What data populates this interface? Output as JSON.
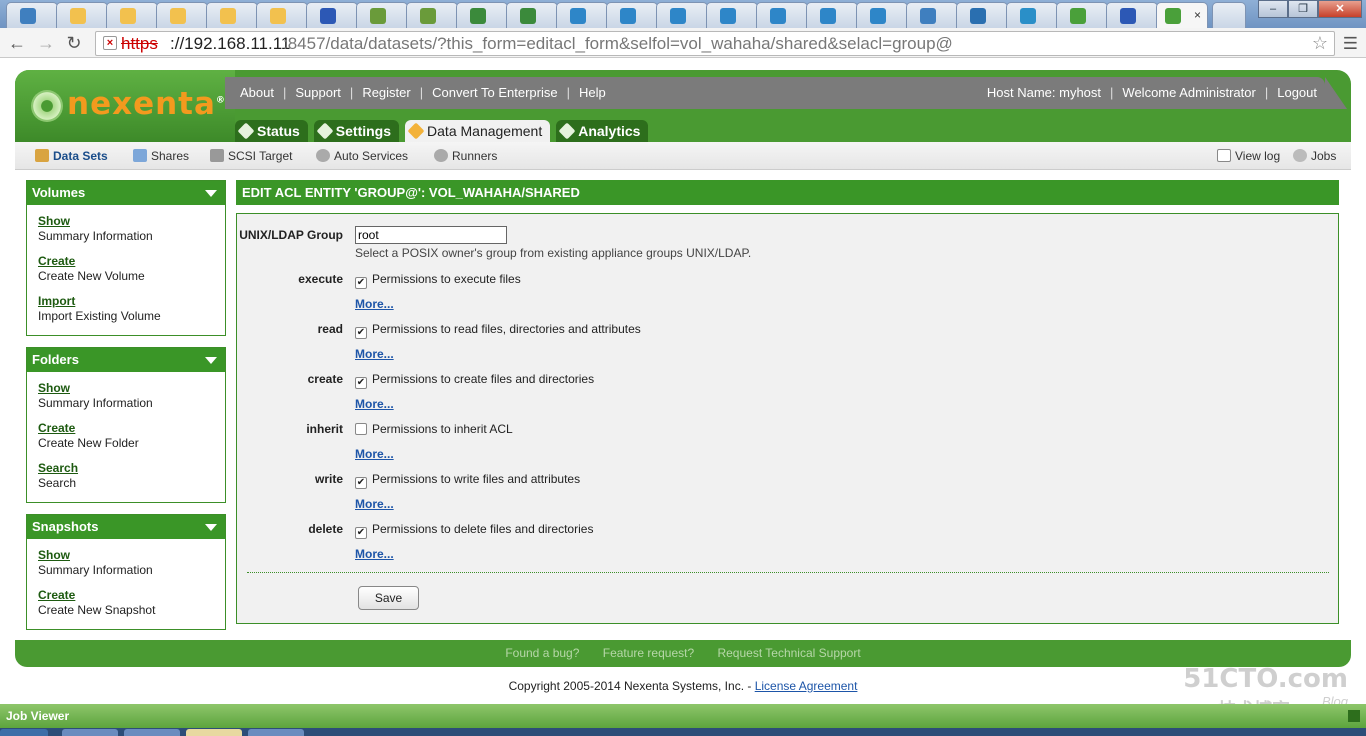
{
  "browser": {
    "tabs": [
      {
        "icon": "nexenta-icon",
        "color": "#3f7fbf"
      },
      {
        "icon": "folder-icon",
        "color": "#f2c14e"
      },
      {
        "icon": "folder-icon",
        "color": "#f2c14e"
      },
      {
        "icon": "folder-icon",
        "color": "#f2c14e"
      },
      {
        "icon": "folder-icon",
        "color": "#f2c14e"
      },
      {
        "icon": "folder-icon",
        "color": "#f2c14e"
      },
      {
        "icon": "paw-icon",
        "color": "#2c58b5"
      },
      {
        "icon": "pencil-icon",
        "color": "#6a9b3a"
      },
      {
        "icon": "pencil-icon",
        "color": "#6a9b3a"
      },
      {
        "icon": "mx-icon",
        "color": "#3b8a3b"
      },
      {
        "icon": "mx-icon",
        "color": "#3b8a3b"
      },
      {
        "icon": "play-circle-icon",
        "color": "#2e86c8"
      },
      {
        "icon": "play-circle-icon",
        "color": "#2e86c8"
      },
      {
        "icon": "play-circle-icon",
        "color": "#2e86c8"
      },
      {
        "icon": "play-circle-icon",
        "color": "#2e86c8"
      },
      {
        "icon": "play-circle-icon",
        "color": "#2e86c8"
      },
      {
        "icon": "play-circle-icon",
        "color": "#2e86c8"
      },
      {
        "icon": "play-circle-icon",
        "color": "#2e86c8"
      },
      {
        "icon": "nexenta-icon",
        "color": "#3f7fbf"
      },
      {
        "icon": "home-icon",
        "color": "#2a6fb0"
      },
      {
        "icon": "app-icon",
        "color": "#2a8fc8"
      },
      {
        "icon": "nexenta-leaf-icon",
        "color": "#4aa03a"
      },
      {
        "icon": "paw-icon",
        "color": "#2c58b5"
      }
    ],
    "active_tab_icon": "nexenta-leaf-icon",
    "active_tab_close": "×",
    "window_controls": {
      "minimize": "‒",
      "maximize": "❐",
      "close": "✕"
    },
    "url_scheme": "https",
    "url_host": "://192.168.11.11",
    "url_path": ":8457/data/datasets/?this_form=editacl_form&selfol=vol_wahaha/shared&selacl=group@"
  },
  "header": {
    "logo_text": "nexenta",
    "logo_tm": "®",
    "top_links": [
      "About",
      "Support",
      "Register",
      "Convert To Enterprise",
      "Help"
    ],
    "host_name": "Host Name: myhost",
    "welcome": "Welcome Administrator",
    "logout": "Logout",
    "main_tabs": [
      "Status",
      "Settings",
      "Data Management",
      "Analytics"
    ],
    "active_tab": "Data Management"
  },
  "subnav": {
    "items": [
      "Data Sets",
      "Shares",
      "SCSI Target",
      "Auto Services",
      "Runners"
    ],
    "current": "Data Sets",
    "right_items": [
      "View log",
      "Jobs"
    ]
  },
  "sidebar": {
    "panels": [
      {
        "title": "Volumes",
        "items": [
          {
            "link": "Show",
            "desc": "Summary Information"
          },
          {
            "link": "Create",
            "desc": "Create New Volume"
          },
          {
            "link": "Import",
            "desc": "Import Existing Volume"
          }
        ]
      },
      {
        "title": "Folders",
        "items": [
          {
            "link": "Show",
            "desc": "Summary Information"
          },
          {
            "link": "Create",
            "desc": "Create New Folder"
          },
          {
            "link": "Search",
            "desc": "Search"
          }
        ]
      },
      {
        "title": "Snapshots",
        "items": [
          {
            "link": "Show",
            "desc": "Summary Information"
          },
          {
            "link": "Create",
            "desc": "Create New Snapshot"
          }
        ]
      }
    ]
  },
  "form": {
    "title": "EDIT ACL ENTITY 'GROUP@': VOL_WAHAHA/SHARED",
    "group_label": "UNIX/LDAP Group",
    "group_value": "root",
    "group_help": "Select a POSIX owner's group from existing appliance groups UNIX/LDAP.",
    "more_label": "More...",
    "permissions": [
      {
        "label": "execute",
        "text": "Permissions to execute files",
        "checked": true
      },
      {
        "label": "read",
        "text": "Permissions to read files, directories and attributes",
        "checked": true
      },
      {
        "label": "create",
        "text": "Permissions to create files and directories",
        "checked": true
      },
      {
        "label": "inherit",
        "text": "Permissions to inherit ACL",
        "checked": false
      },
      {
        "label": "write",
        "text": "Permissions to write files and attributes",
        "checked": true
      },
      {
        "label": "delete",
        "text": "Permissions to delete files and directories",
        "checked": true
      }
    ],
    "save_label": "Save"
  },
  "footer": {
    "links": [
      "Found a bug?",
      "Feature request?",
      "Request Technical Support"
    ],
    "copyright": "Copyright 2005-2014 Nexenta Systems, Inc. - ",
    "license": "License Agreement"
  },
  "watermark": {
    "main": "51CTO.com",
    "sub": "技术博客",
    "blog": "Blog"
  },
  "job_viewer": {
    "title": "Job Viewer"
  },
  "colors": {
    "brand_green": "#4a9a32",
    "panel_green": "#3a9627",
    "logo_orange": "#f39a1e",
    "link_blue": "#1d55a8"
  }
}
